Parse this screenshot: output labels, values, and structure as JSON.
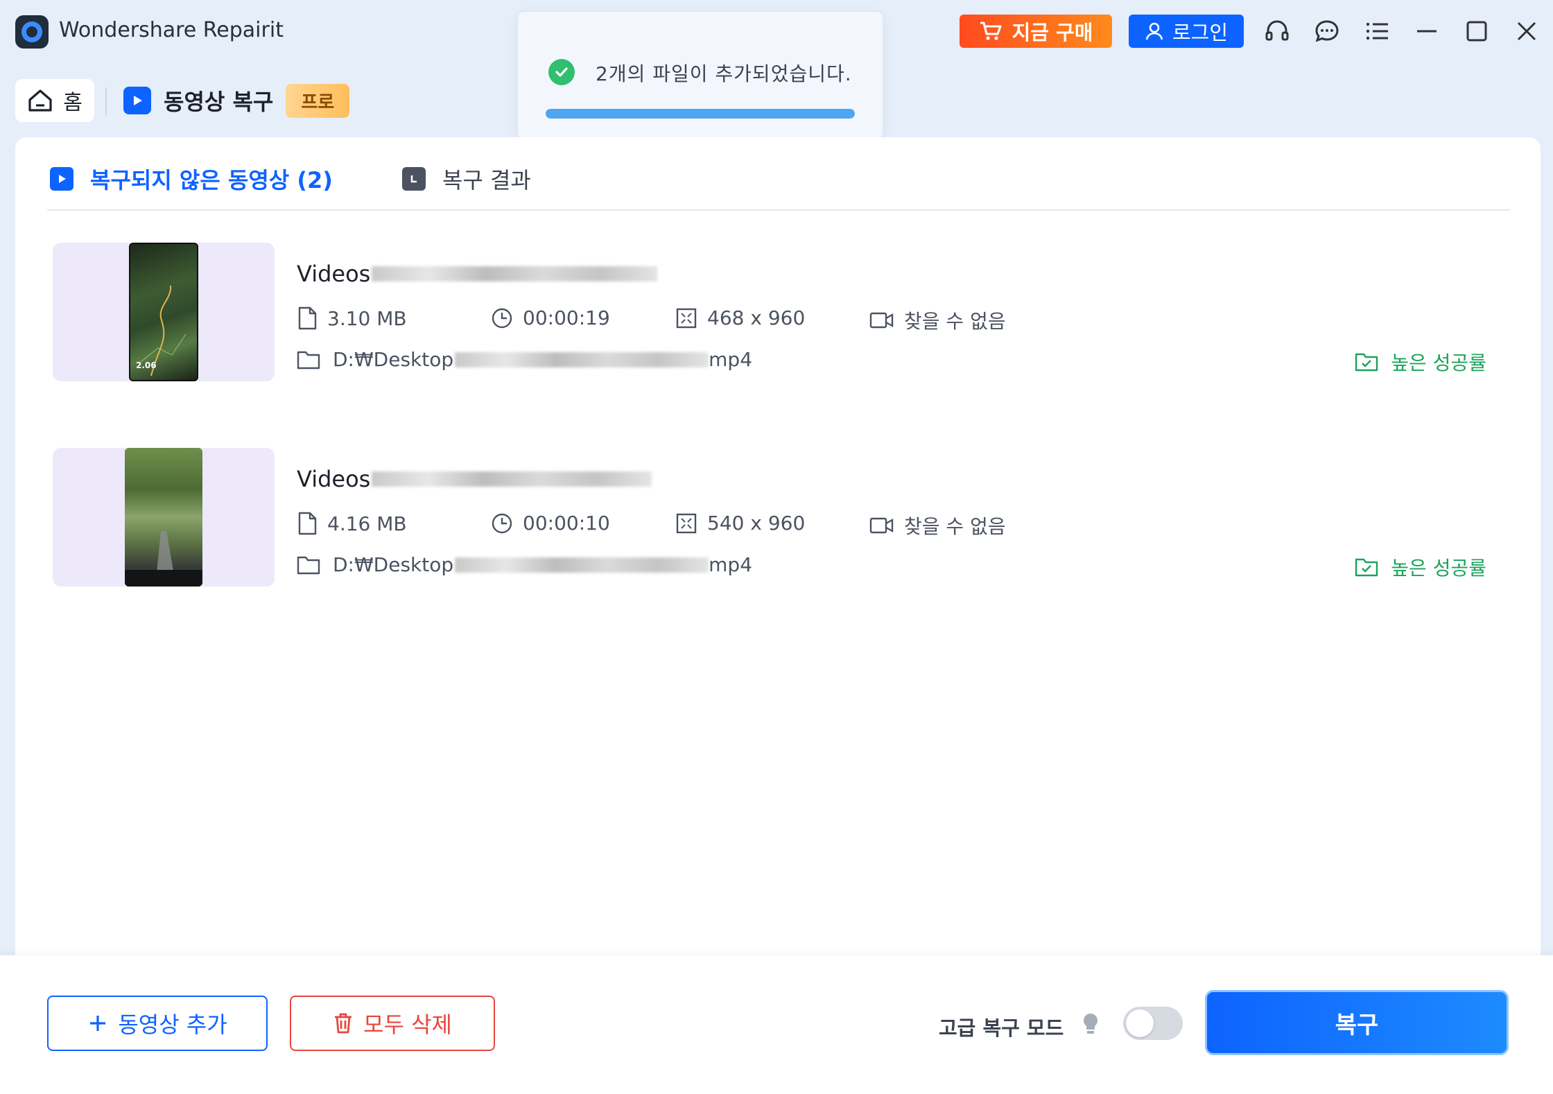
{
  "app": {
    "title": "Wondershare Repairit"
  },
  "titlebar": {
    "buy_label": "지금 구매",
    "login_label": "로그인"
  },
  "toast": {
    "message": "2개의 파일이 추가되었습니다.",
    "progress": 1.0
  },
  "nav": {
    "home_label": "홈",
    "section_label": "동영상 복구",
    "badge": "프로"
  },
  "tabs": [
    {
      "label": "복구되지 않은 동영상 (2)",
      "active": true
    },
    {
      "label": "복구 결과",
      "active": false
    }
  ],
  "files": [
    {
      "name_prefix": "Videos",
      "size": "3.10 MB",
      "duration": "00:00:19",
      "resolution": "468 x 960",
      "camera": "찾을 수 없음",
      "path_prefix": "D:₩Desktop",
      "path_suffix": "mp4",
      "status": "높은 성공률"
    },
    {
      "name_prefix": "Videos",
      "size": "4.16 MB",
      "duration": "00:00:10",
      "resolution": "540 x 960",
      "camera": "찾을 수 없음",
      "path_prefix": "D:₩Desktop",
      "path_suffix": "mp4",
      "status": "높은 성공률"
    }
  ],
  "thumb1_overlay": "2.06",
  "bottom": {
    "add_label": "동영상 추가",
    "delete_label": "모두 삭제",
    "advanced_label": "고급 복구 모드",
    "advanced_on": false,
    "repair_label": "복구"
  },
  "colors": {
    "accent": "#0d63ff",
    "success": "#19a35a",
    "danger": "#e8453c",
    "buy": "#ff5a1f"
  }
}
